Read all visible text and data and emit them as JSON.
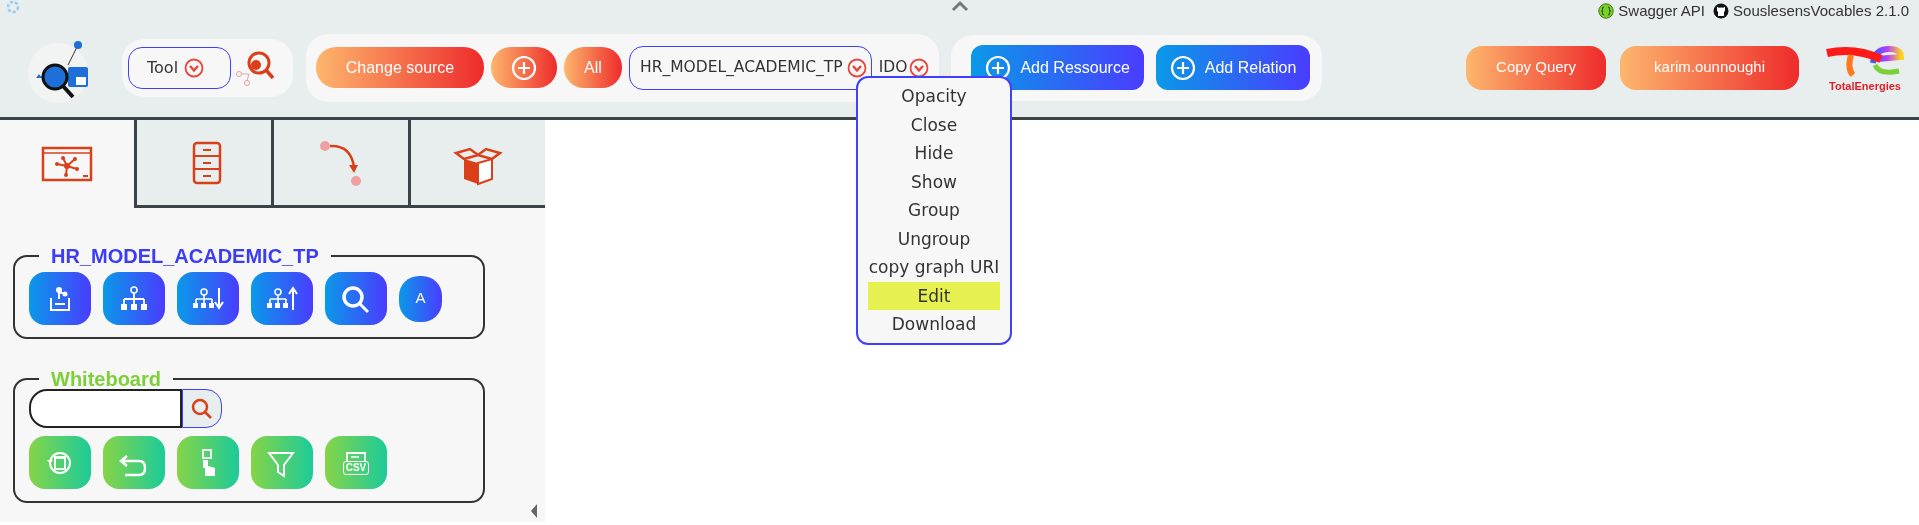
{
  "top_links": [
    {
      "kind": "swagger",
      "label": "Swagger API"
    },
    {
      "kind": "github",
      "label": "SouslesensVocables 2.1.0"
    }
  ],
  "tool_select": {
    "value": "Tool"
  },
  "source_bar": {
    "change_source": "Change source",
    "all": "All",
    "source_select": "HR_MODEL_ACADEMIC_TP",
    "secondary_select": "IDO"
  },
  "add_buttons": [
    "Add Ressource",
    "Add Relation"
  ],
  "right_buttons": [
    "Copy Query",
    "karim.ounnoughi"
  ],
  "brand_text": "TotalEnergies",
  "tabs": [
    {
      "kind": "graph",
      "selected": true
    },
    {
      "kind": "cabinet",
      "selected": false
    },
    {
      "kind": "relation",
      "selected": false
    },
    {
      "kind": "box",
      "selected": false
    }
  ],
  "sections": [
    {
      "kind": "source",
      "title": "HR_MODEL_ACADEMIC_TP",
      "color": "#3c3cf5",
      "text_button": "A"
    },
    {
      "kind": "whiteboard",
      "title": "Whiteboard",
      "color": "#7ed03a",
      "csv_label": "CSV"
    }
  ],
  "context_menu": [
    {
      "label": "Opacity",
      "selected": false
    },
    {
      "label": "Close",
      "selected": false
    },
    {
      "label": "Hide",
      "selected": false
    },
    {
      "label": "Show",
      "selected": false
    },
    {
      "label": "Group",
      "selected": false
    },
    {
      "label": "Ungroup",
      "selected": false
    },
    {
      "label": "copy graph URI",
      "selected": false
    },
    {
      "label": "Edit",
      "selected": true
    },
    {
      "label": "Download",
      "selected": false
    }
  ]
}
